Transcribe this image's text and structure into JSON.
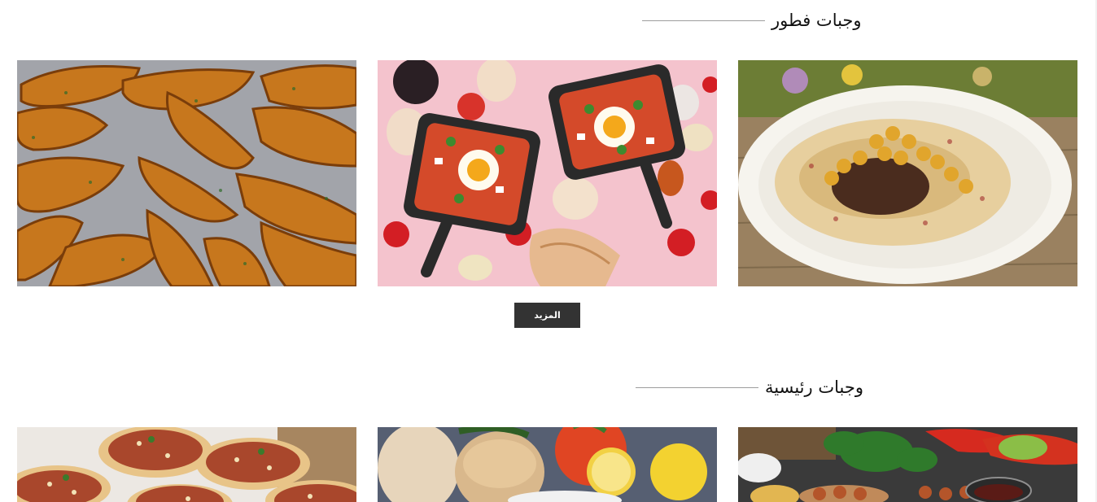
{
  "sections": [
    {
      "title": "وجبات فطور",
      "items": [
        {
          "name": "potato-wedges-image"
        },
        {
          "name": "shakshuka-image"
        },
        {
          "name": "hummus-image"
        }
      ]
    },
    {
      "title": "وجبات رئيسية",
      "items": [
        {
          "name": "lahm-bi-ajeen-image"
        },
        {
          "name": "pita-bread-image"
        },
        {
          "name": "mezze-image"
        }
      ]
    }
  ],
  "more_button": {
    "label": "المزيد"
  },
  "colors": {
    "button_bg": "#333333",
    "divider": "#9d9d9d",
    "title": "#111111"
  }
}
